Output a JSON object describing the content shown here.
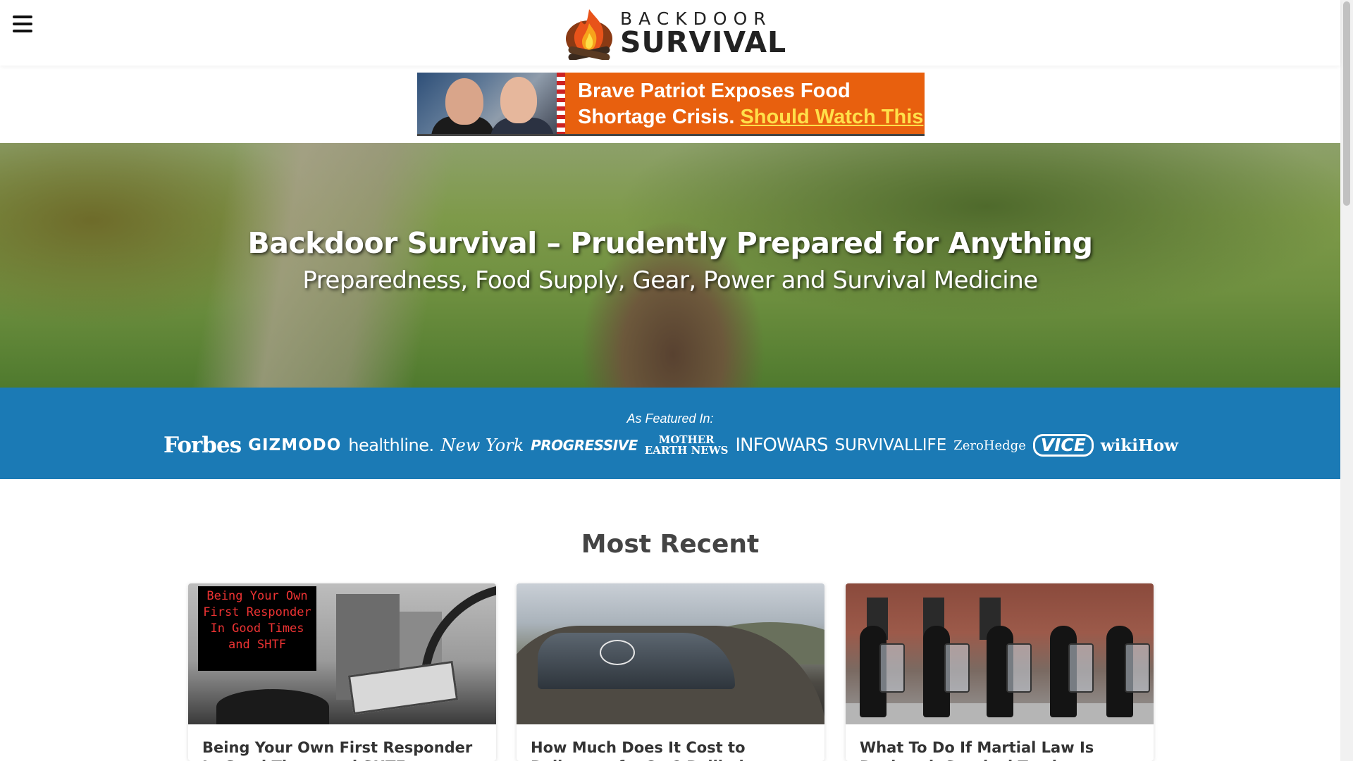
{
  "header": {
    "logo_top": "BACKDOOR",
    "logo_bottom": "SURVIVAL",
    "menu_icon": "hamburger-menu-icon"
  },
  "ad": {
    "headline": "Brave Patriot Exposes Food Shortage Crisis.",
    "cta": "Should Watch This",
    "bg_color": "#e8600e",
    "cta_color": "#ffe04a"
  },
  "hero": {
    "title": "Backdoor Survival – Prudently Prepared for Anything",
    "subtitle": "Preparedness, Food Supply, Gear, Power and Survival Medicine"
  },
  "featured": {
    "label": "As Featured In:",
    "bg_color": "#1b7ab5",
    "logos": [
      "Forbes",
      "GIZMODO",
      "healthline.",
      "New York",
      "PROGRESSIVE",
      "MOTHER EARTH NEWS",
      "INFOWARS",
      "SURVIVALLIFE",
      "ZeroHedge",
      "VICE",
      "wikiHow"
    ]
  },
  "recent": {
    "title": "Most Recent",
    "cards": [
      {
        "title": "Being Your Own First Responder In Good Times and SHTF",
        "image_text": "Being Your Own First Responder In Good Times and SHTF"
      },
      {
        "title": "How Much Does It Cost to Bulletproof a Car? Ballistic Protection Levels & Costs"
      },
      {
        "title": "What To Do If Martial Law Is Declared: Survival Tactics Explained"
      }
    ]
  }
}
